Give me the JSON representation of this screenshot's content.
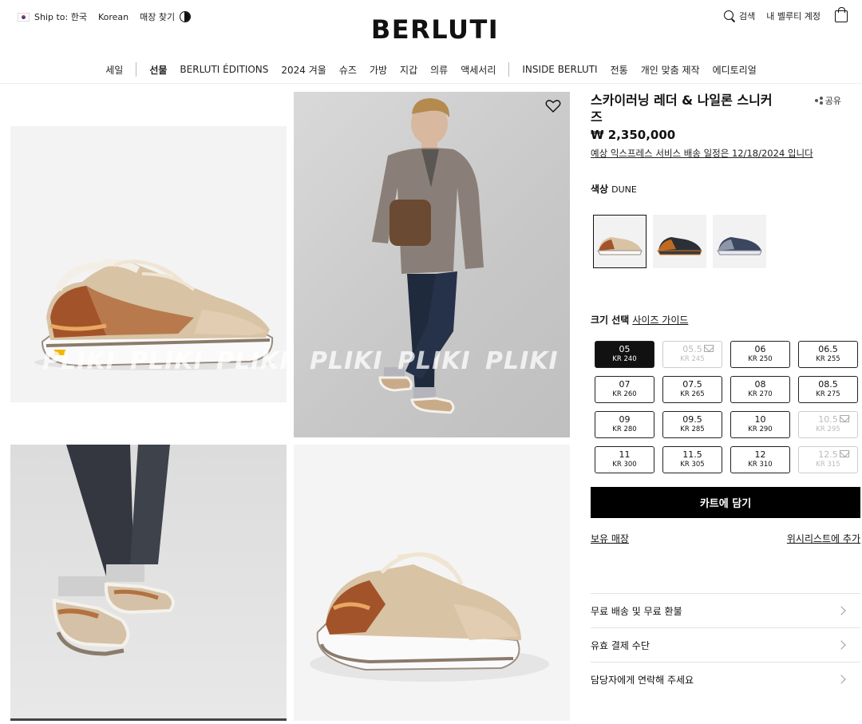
{
  "header": {
    "ship_to": "Ship to: 한국",
    "language": "Korean",
    "store_locator": "매장 찾기",
    "logo": "BERLUTI",
    "search": "검색",
    "account": "내 벨루티 계정"
  },
  "nav": {
    "items": [
      "세일",
      "선물",
      "BERLUTI ÉDITIONS",
      "2024 겨울",
      "슈즈",
      "가방",
      "지갑",
      "의류",
      "액세서리",
      "INSIDE BERLUTI",
      "전통",
      "개인 맞춤 제작",
      "에디토리얼"
    ]
  },
  "gallery": {
    "watermark": "PLIKI"
  },
  "product": {
    "title": "스카이러닝 레더 & 나일론 스니커즈",
    "share": "공유",
    "price": "₩ 2,350,000",
    "delivery": "예상 익스프레스 서비스 배송 일정은 12/18/2024 입니다",
    "color_label": "색상",
    "color_value": "DUNE",
    "size_label": "크기 선택",
    "size_guide": "사이즈 가이드",
    "sizes": [
      {
        "size": "05",
        "kr": "KR 240",
        "state": "selected"
      },
      {
        "size": "05.5",
        "kr": "KR 245",
        "state": "oos"
      },
      {
        "size": "06",
        "kr": "KR 250",
        "state": "available"
      },
      {
        "size": "06.5",
        "kr": "KR 255",
        "state": "available"
      },
      {
        "size": "07",
        "kr": "KR 260",
        "state": "available"
      },
      {
        "size": "07.5",
        "kr": "KR 265",
        "state": "available"
      },
      {
        "size": "08",
        "kr": "KR 270",
        "state": "available"
      },
      {
        "size": "08.5",
        "kr": "KR 275",
        "state": "available"
      },
      {
        "size": "09",
        "kr": "KR 280",
        "state": "available"
      },
      {
        "size": "09.5",
        "kr": "KR 285",
        "state": "available"
      },
      {
        "size": "10",
        "kr": "KR 290",
        "state": "available"
      },
      {
        "size": "10.5",
        "kr": "KR 295",
        "state": "oos"
      },
      {
        "size": "11",
        "kr": "KR 300",
        "state": "available"
      },
      {
        "size": "11.5",
        "kr": "KR 305",
        "state": "available"
      },
      {
        "size": "12",
        "kr": "KR 310",
        "state": "available"
      },
      {
        "size": "12.5",
        "kr": "KR 315",
        "state": "oos"
      }
    ],
    "add_to_cart": "카트에 담기",
    "store_stock": "보유 매장",
    "wishlist": "위시리스트에 추가",
    "accordion": [
      "무료 배송 및 무료 환불",
      "유효 결제 수단",
      "담당자에게 연락해 주세요"
    ]
  }
}
